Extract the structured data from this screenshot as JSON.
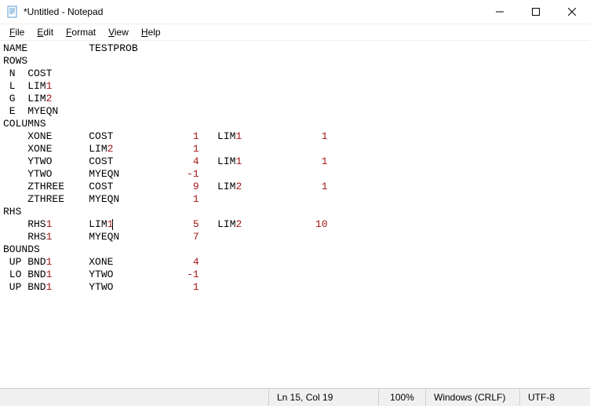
{
  "window": {
    "title": "*Untitled - Notepad"
  },
  "menu": {
    "file": "File",
    "edit": "Edit",
    "format": "Format",
    "view": "View",
    "help": "Help"
  },
  "content_lines": [
    "NAME          TESTPROB",
    "ROWS",
    " N  COST",
    " L  LIM1",
    " G  LIM2",
    " E  MYEQN",
    "COLUMNS",
    "    XONE      COST             1   LIM1             1",
    "    XONE      LIM2             1",
    "    YTWO      COST             4   LIM1             1",
    "    YTWO      MYEQN           -1",
    "    ZTHREE    COST             9   LIM2             1",
    "    ZTHREE    MYEQN            1",
    "RHS",
    "    RHS1      LIM1             5   LIM2            10",
    "    RHS1      MYEQN            7",
    "BOUNDS",
    " UP BND1      XONE             4",
    " LO BND1      YTWO            -1",
    " UP BND1      YTWO             1"
  ],
  "caret": {
    "line_index": 14,
    "col_index": 18
  },
  "status": {
    "position": "Ln 15, Col 19",
    "zoom": "100%",
    "eol": "Windows (CRLF)",
    "encoding": "UTF-8"
  }
}
